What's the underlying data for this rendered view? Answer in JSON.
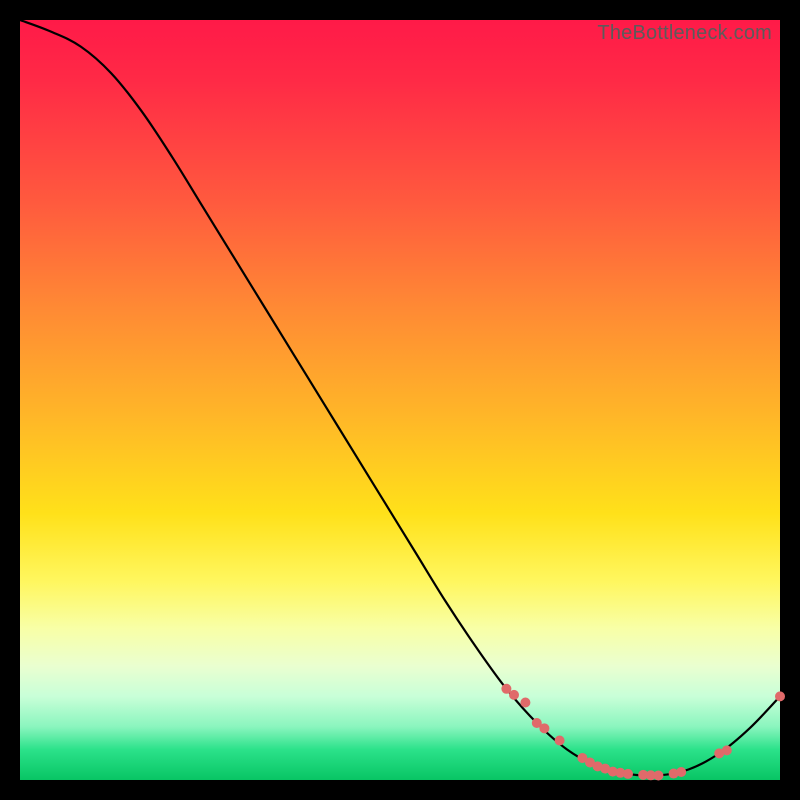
{
  "watermark": "TheBottleneck.com",
  "chart_data": {
    "type": "line",
    "title": "",
    "xlabel": "",
    "ylabel": "",
    "xlim": [
      0,
      100
    ],
    "ylim": [
      0,
      100
    ],
    "grid": false,
    "legend": false,
    "series": [
      {
        "name": "curve",
        "color": "#000000",
        "x": [
          0,
          4,
          8,
          12,
          16,
          20,
          24,
          28,
          32,
          36,
          40,
          44,
          48,
          52,
          56,
          60,
          64,
          68,
          72,
          76,
          80,
          84,
          88,
          92,
          96,
          100
        ],
        "y": [
          100,
          98.5,
          96.5,
          93,
          88,
          82,
          75.5,
          69,
          62.5,
          56,
          49.5,
          43,
          36.5,
          30,
          23.5,
          17.5,
          12,
          7.5,
          4,
          1.8,
          0.8,
          0.6,
          1.4,
          3.5,
          6.8,
          11
        ]
      }
    ],
    "markers": {
      "name": "dots",
      "color": "#e06a6a",
      "radius_px": 5,
      "x": [
        64,
        65,
        66.5,
        68,
        69,
        71,
        74,
        75,
        76,
        77,
        78,
        79,
        80,
        82,
        83,
        84,
        86,
        87,
        92,
        93,
        100
      ],
      "y": [
        12,
        11.2,
        10.2,
        7.5,
        6.8,
        5.2,
        2.9,
        2.3,
        1.8,
        1.5,
        1.1,
        0.95,
        0.8,
        0.68,
        0.62,
        0.6,
        0.85,
        1.05,
        3.5,
        3.9,
        11
      ]
    }
  }
}
